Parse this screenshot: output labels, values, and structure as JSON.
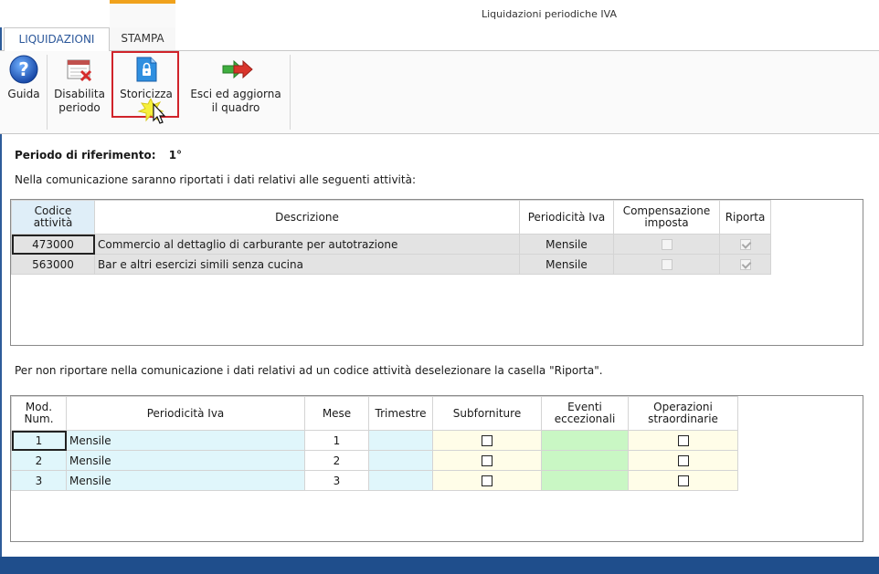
{
  "window": {
    "title": "Liquidazioni periodiche IVA"
  },
  "tabs": [
    {
      "label": "LIQUIDAZIONI"
    },
    {
      "label": "STAMPA"
    }
  ],
  "ribbon": {
    "guida": "Guida",
    "disabilita_line1": "Disabilita",
    "disabilita_line2": "periodo",
    "storicizza": "Storicizza",
    "esci_line1": "Esci ed aggiorna",
    "esci_line2": "il quadro"
  },
  "period": {
    "label": "Periodo di riferimento:",
    "value": "1°"
  },
  "intro_text": "Nella comunicazione saranno riportati i dati relativi alle seguenti attività:",
  "activities": {
    "headers": {
      "codice_line1": "Codice",
      "codice_line2": "attività",
      "descrizione": "Descrizione",
      "periodicita": "Periodicità Iva",
      "comp_line1": "Compensazione",
      "comp_line2": "imposta",
      "riporta": "Riporta"
    },
    "rows": [
      {
        "codice": "473000",
        "descrizione": "Commercio al dettaglio di carburante per autotrazione",
        "periodicita": "Mensile",
        "compensazione": false,
        "riporta": true
      },
      {
        "codice": "563000",
        "descrizione": "Bar e altri esercizi simili senza cucina",
        "periodicita": "Mensile",
        "compensazione": false,
        "riporta": true
      }
    ]
  },
  "note_text": "Per non riportare nella comunicazione i dati relativi ad un codice attività deselezionare la casella \"Riporta\".",
  "modules": {
    "headers": {
      "mod_line1": "Mod.",
      "mod_line2": "Num.",
      "periodicita": "Periodicità Iva",
      "mese": "Mese",
      "trimestre": "Trimestre",
      "subforniture": "Subforniture",
      "eventi_line1": "Eventi",
      "eventi_line2": "eccezionali",
      "oper_line1": "Operazioni",
      "oper_line2": "straordinarie"
    },
    "rows": [
      {
        "num": "1",
        "periodicita": "Mensile",
        "mese": "1",
        "trimestre": "",
        "subforniture": false,
        "operazioni": false
      },
      {
        "num": "2",
        "periodicita": "Mensile",
        "mese": "2",
        "trimestre": "",
        "subforniture": false,
        "operazioni": false
      },
      {
        "num": "3",
        "periodicita": "Mensile",
        "mese": "3",
        "trimestre": "",
        "subforniture": false,
        "operazioni": false
      }
    ]
  },
  "colors": {
    "accent": "#2b579a",
    "highlight": "#d0232a",
    "tab_marker": "#f0a21c",
    "status_bar": "#1f4e8c"
  },
  "icons": {
    "guida": "help-icon",
    "disabilita": "calendar-disable-icon",
    "storicizza": "lock-document-icon",
    "esci": "exit-arrow-icon"
  }
}
